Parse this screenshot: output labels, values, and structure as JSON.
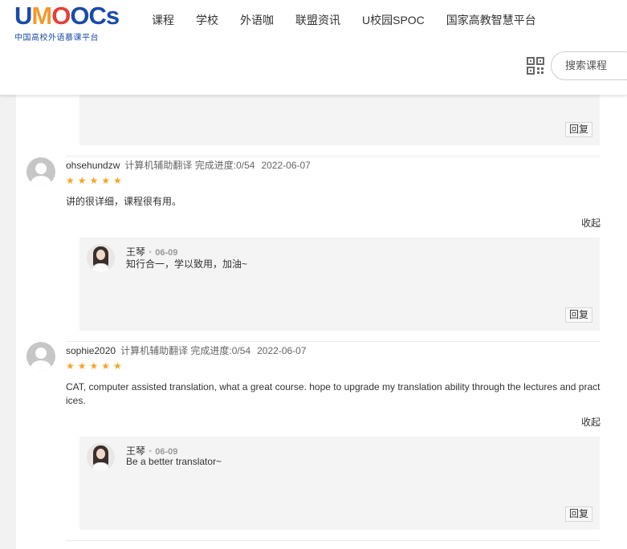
{
  "header": {
    "logo_text": "UMOOCs",
    "logo_subtitle": "中国高校外语慕课平台",
    "nav": [
      "课程",
      "学校",
      "外语咖",
      "联盟资讯",
      "U校园SPOC",
      "国家高教智慧平台"
    ],
    "search_placeholder": "搜索课程"
  },
  "reply_button_label": "回复",
  "collapse_label": "收起",
  "reviews": [
    {
      "user": "ohsehundzw",
      "course": "计算机辅助翻译",
      "progress": "完成进度:0/54",
      "date": "2022-06-07",
      "stars": 5,
      "stars_text": "★★★★★",
      "text": "讲的很详细，课程很有用。",
      "reply": {
        "name": "王琴",
        "date": "06-09",
        "text": "知行合一，学以致用，加油~"
      }
    },
    {
      "user": "sophie2020",
      "course": "计算机辅助翻译",
      "progress": "完成进度:0/54",
      "date": "2022-06-07",
      "stars": 5,
      "stars_text": "★★★★★",
      "text": "CAT, computer assisted translation, what a great course. hope to upgrade my translation ability through the lectures and practices.",
      "reply": {
        "name": "王琴",
        "date": "06-09",
        "text": "Be a better translator~"
      }
    }
  ],
  "colors": {
    "brand_blue": "#1a4ba8",
    "star": "#f5a623",
    "reply_bg": "#f4f4f4"
  }
}
